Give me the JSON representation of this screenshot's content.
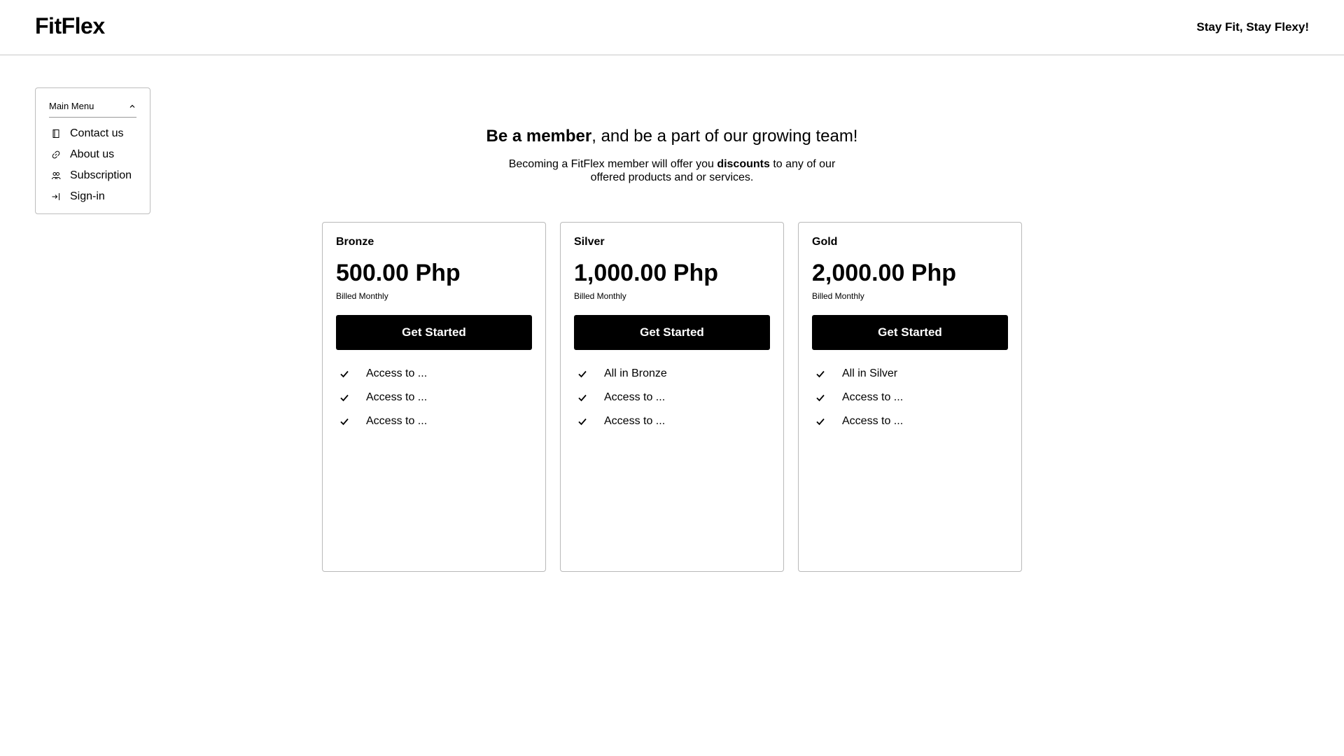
{
  "header": {
    "logo": "FitFlex",
    "tagline": "Stay Fit, Stay Flexy!"
  },
  "menu": {
    "title": "Main Menu",
    "toggle_icon": "chevron-up-icon",
    "items": [
      {
        "label": "Contact us",
        "icon": "book-icon"
      },
      {
        "label": "About us",
        "icon": "link-icon"
      },
      {
        "label": "Subscription",
        "icon": "users-icon"
      },
      {
        "label": "Sign-in",
        "icon": "sign-in-icon"
      }
    ]
  },
  "hero": {
    "title_bold": "Be a member",
    "title_rest": ", and be a part of our growing team!",
    "subtitle_pre": "Becoming a FitFlex member will offer you ",
    "subtitle_bold": "discounts",
    "subtitle_post": " to any of our offered products and or services."
  },
  "plans": [
    {
      "tier": "Bronze",
      "price": "500.00 Php",
      "billing": "Billed Monthly",
      "cta": "Get Started",
      "features": [
        "Access to ...",
        "Access to ...",
        "Access to ..."
      ]
    },
    {
      "tier": "Silver",
      "price": "1,000.00 Php",
      "billing": "Billed Monthly",
      "cta": "Get Started",
      "features": [
        "All in Bronze",
        "Access to ...",
        "Access to ..."
      ]
    },
    {
      "tier": "Gold",
      "price": "2,000.00 Php",
      "billing": "Billed Monthly",
      "cta": "Get Started",
      "features": [
        "All in Silver",
        "Access to ...",
        "Access to ..."
      ]
    }
  ],
  "colors": {
    "primary": "#000000",
    "background": "#ffffff",
    "border": "#bdbdbd"
  }
}
